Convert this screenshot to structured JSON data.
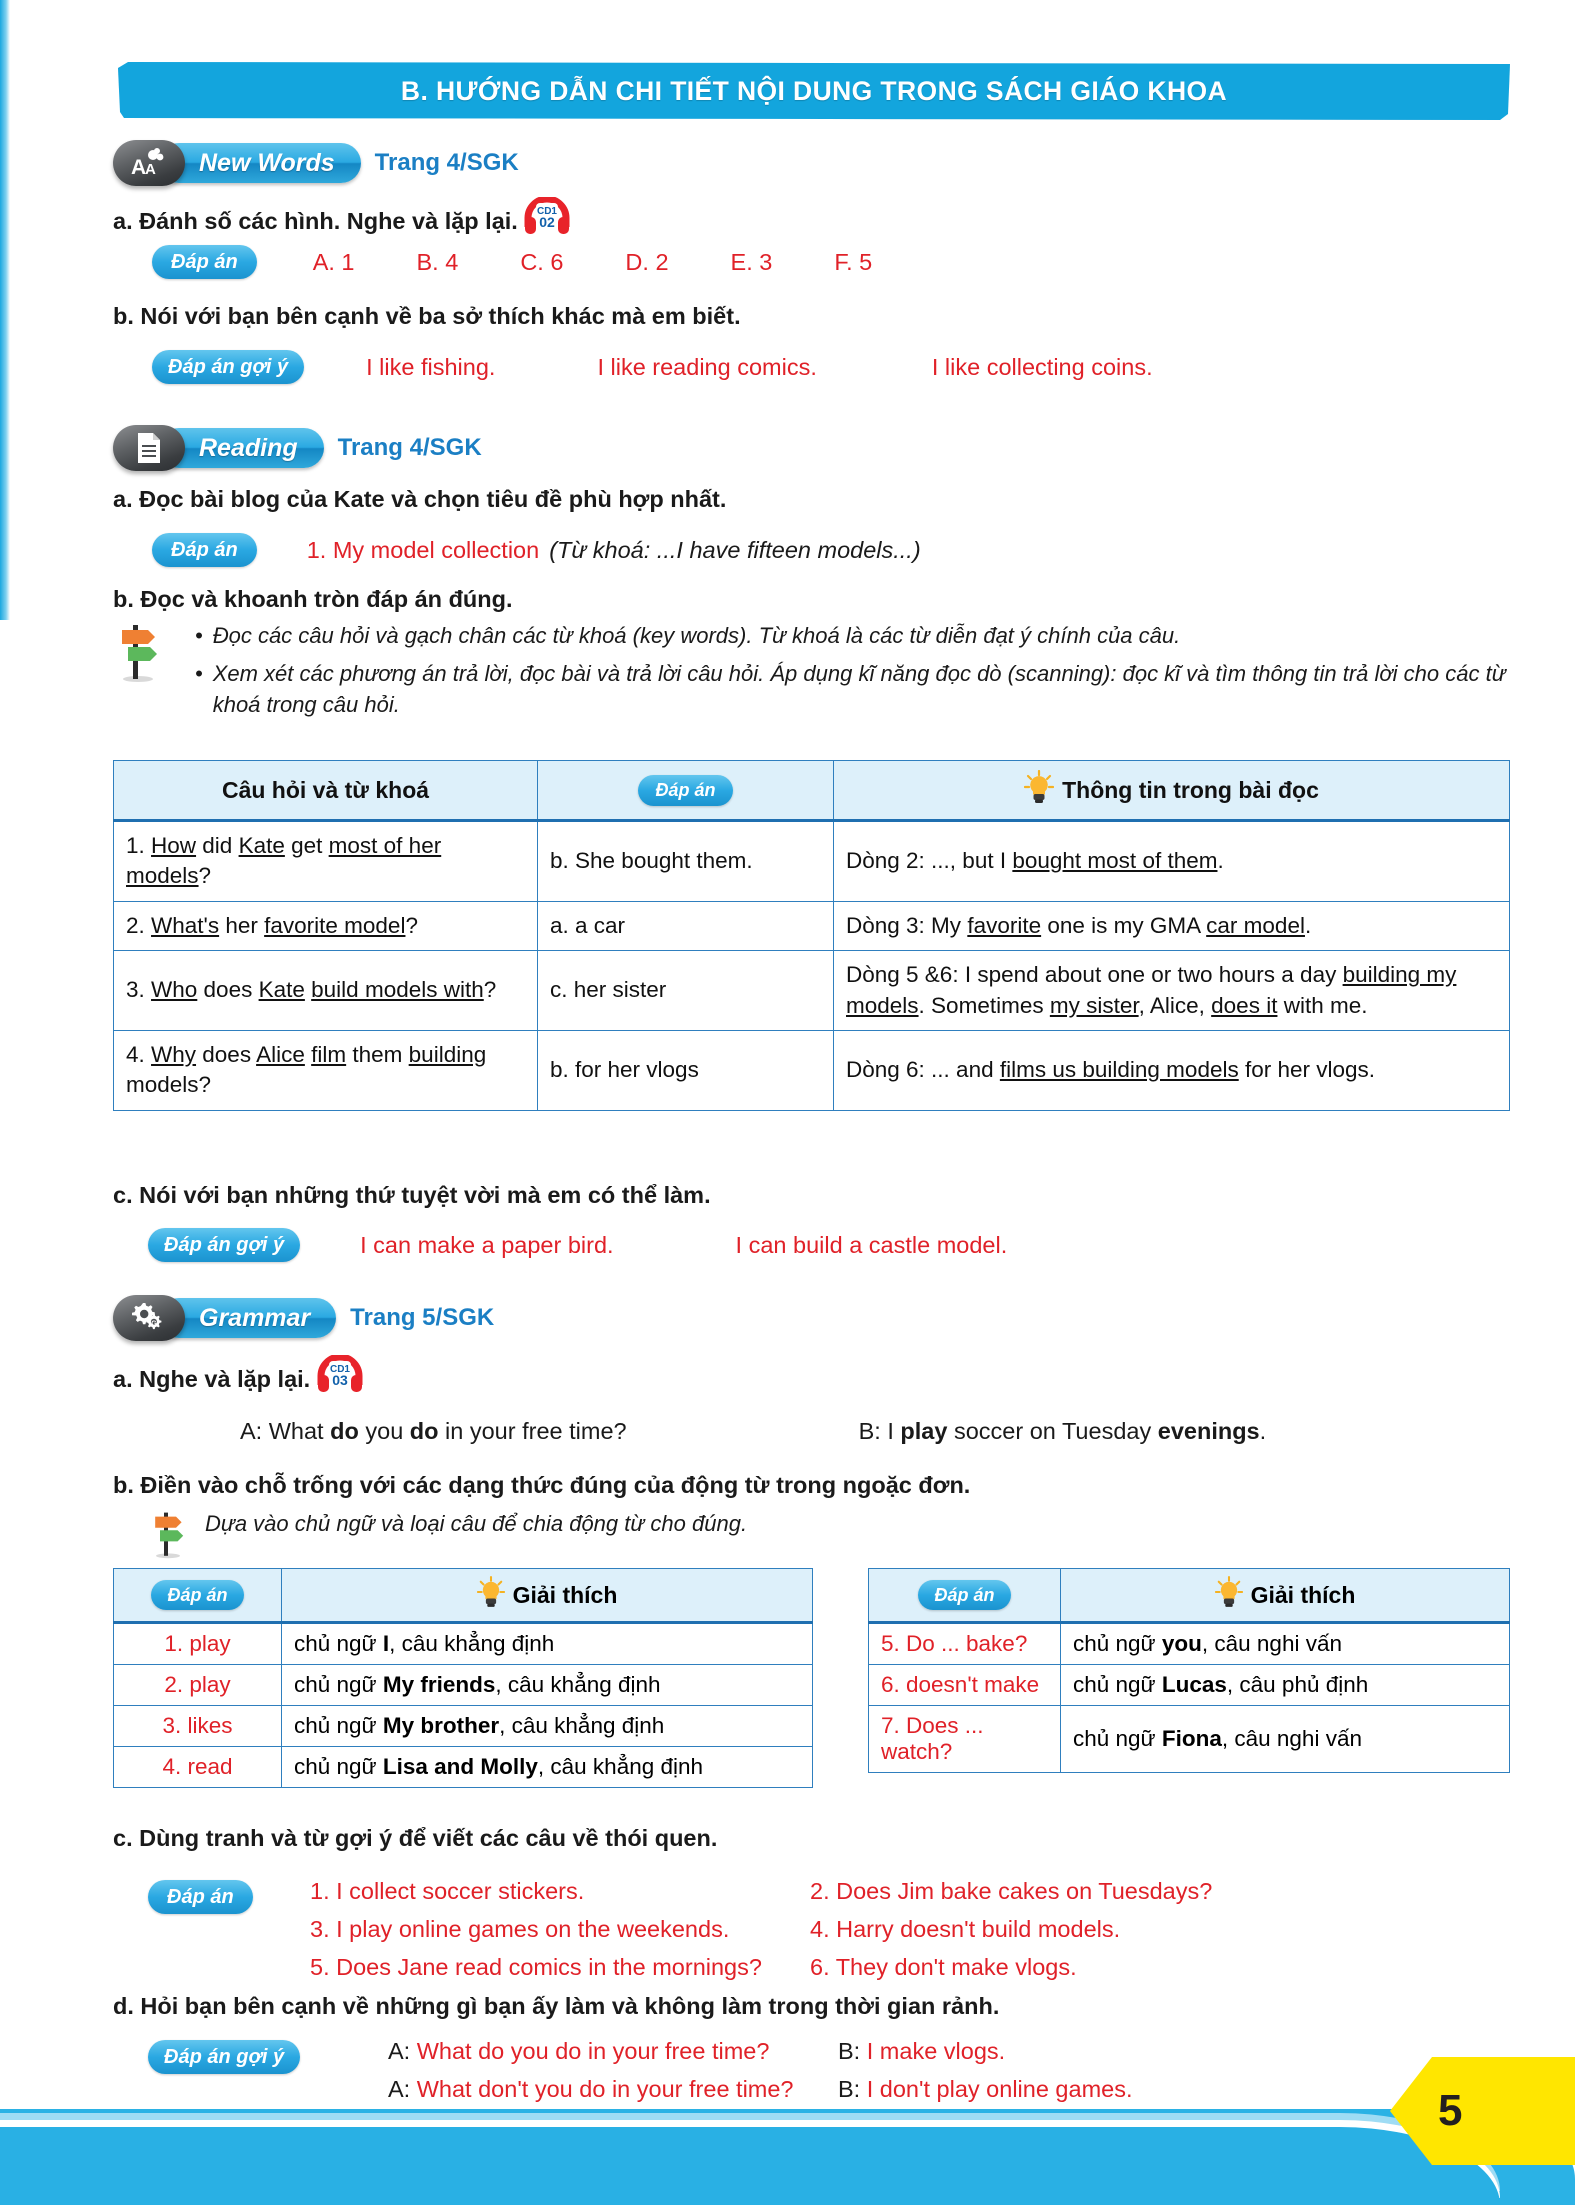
{
  "banner": {
    "title": "B. HƯỚNG DẪN CHI TIẾT NỘI DUNG TRONG SÁCH GIÁO KHOA"
  },
  "sections": {
    "new_words": {
      "name": "New Words",
      "page_ref": "Trang 4/SGK",
      "icon": "aa-letters-icon",
      "a": {
        "prompt": "a. Đánh số các hình. Nghe và lặp lại.",
        "audio": {
          "cd": "CD1",
          "track": "02"
        },
        "chip": "Đáp án",
        "answers": [
          "A. 1",
          "B. 4",
          "C. 6",
          "D. 2",
          "E. 3",
          "F. 5"
        ]
      },
      "b": {
        "prompt": "b. Nói với bạn bên cạnh về ba sở thích khác mà em biết.",
        "chip": "Đáp án gợi ý",
        "answers": [
          "I like fishing.",
          "I like reading comics.",
          "I like collecting coins."
        ]
      }
    },
    "reading": {
      "name": "Reading",
      "page_ref": "Trang 4/SGK",
      "icon": "document-icon",
      "a": {
        "prompt": "a. Đọc bài blog của Kate và chọn tiêu đề phù hợp nhất.",
        "chip": "Đáp án",
        "answer": "1. My model collection",
        "note": "(Từ khoá: ...I have fifteen models...)"
      },
      "b": {
        "prompt": "b. Đọc và khoanh tròn đáp án đúng.",
        "tips": [
          "Đọc các câu hỏi và gạch chân các từ khoá (key words). Từ khoá là các từ diễn đạt ý chính của câu.",
          "Xem xét các phương án trả lời, đọc bài và trả lời câu hỏi. Áp dụng kĩ năng đọc dò (scanning): đọc kĩ và tìm thông tin trả lời cho các từ khoá trong câu hỏi."
        ],
        "table": {
          "headers": [
            "Câu hỏi và từ khoá",
            "Đáp án",
            "Thông tin trong bài đọc"
          ],
          "rows": [
            {
              "question": "1. How did Kate get most of her models?",
              "answer": "b. She bought them.",
              "info": "Dòng 2: ..., but I bought most of them."
            },
            {
              "question": "2. What's her favorite model?",
              "answer": "a. a car",
              "info": "Dòng 3: My favorite one is my GMA car model."
            },
            {
              "question": "3. Who does Kate build models with?",
              "answer": "c. her sister",
              "info": "Dòng 5 &6: I spend about one or two hours a day building my models. Sometimes my sister, Alice, does it with me."
            },
            {
              "question": "4. Why does Alice film them building models?",
              "answer": "b. for her vlogs",
              "info": "Dòng 6: ... and films us building models for her vlogs."
            }
          ]
        }
      },
      "c": {
        "prompt": "c. Nói với bạn những thứ tuyệt vời mà em có thể làm.",
        "chip": "Đáp án gợi ý",
        "answers": [
          "I can make a paper bird.",
          "I can build a castle model."
        ]
      }
    },
    "grammar": {
      "name": "Grammar",
      "page_ref": "Trang 5/SGK",
      "icon": "gears-icon",
      "a": {
        "prompt": "a. Nghe và lặp lại.",
        "audio": {
          "cd": "CD1",
          "track": "03"
        },
        "dialog_a_pre": "A: What ",
        "dialog_a_b1": "do",
        "dialog_a_mid": " you ",
        "dialog_a_b2": "do",
        "dialog_a_post": " in your free time?",
        "dialog_b_pre": "B: I ",
        "dialog_b_b1": "play",
        "dialog_b_mid": " soccer on Tuesday ",
        "dialog_b_b2": "evenings",
        "dialog_b_post": "."
      },
      "b": {
        "prompt": "b. Điền vào chỗ trống với các dạng thức đúng của động từ trong ngoặc đơn.",
        "tip": "Dựa vào chủ ngữ và loại câu để chia động từ cho đúng.",
        "table_left": {
          "headers": [
            "Đáp án",
            "Giải thích"
          ],
          "rows": [
            {
              "answer": "1. play",
              "pre": "chủ ngữ ",
              "bold": "I",
              "post": ", câu khẳng định"
            },
            {
              "answer": "2. play",
              "pre": "chủ ngữ ",
              "bold": "My friends",
              "post": ", câu khẳng định"
            },
            {
              "answer": "3. likes",
              "pre": "chủ ngữ ",
              "bold": "My brother",
              "post": ", câu khẳng định"
            },
            {
              "answer": "4. read",
              "pre": "chủ ngữ ",
              "bold": "Lisa and Molly",
              "post": ", câu khẳng định"
            }
          ]
        },
        "table_right": {
          "headers": [
            "Đáp án",
            "Giải thích"
          ],
          "rows": [
            {
              "answer": "5. Do ... bake?",
              "pre": "chủ ngữ ",
              "bold": "you",
              "post": ", câu nghi vấn"
            },
            {
              "answer": "6. doesn't make",
              "pre": "chủ ngữ ",
              "bold": "Lucas",
              "post": ", câu phủ định"
            },
            {
              "answer": "7. Does ... watch?",
              "pre": "chủ ngữ ",
              "bold": "Fiona",
              "post": ", câu nghi vấn"
            }
          ]
        }
      },
      "c": {
        "prompt": "c. Dùng tranh và từ gợi ý để viết các câu về thói quen.",
        "chip": "Đáp án",
        "answers": [
          "1. I collect soccer stickers.",
          "2. Does Jim bake cakes on Tuesdays?",
          "3. I play online games on the weekends.",
          "4. Harry doesn't build models.",
          "5. Does Jane read comics in the mornings?",
          "6. They don't make vlogs."
        ]
      },
      "d": {
        "prompt": "d. Hỏi bạn bên cạnh về những gì bạn ấy làm và không làm trong thời gian rảnh.",
        "chip": "Đáp án gợi ý",
        "lines": [
          {
            "a_label": "A: ",
            "a_text": "What do you do in your free time?",
            "b_label": "B: ",
            "b_text": "I make vlogs."
          },
          {
            "a_label": "A: ",
            "a_text": "What don't you do in your free time?",
            "b_label": "B: ",
            "b_text": "I don't play online games."
          }
        ]
      }
    }
  },
  "footer": {
    "page_number": "5"
  },
  "colors": {
    "accent_blue": "#13a5dd",
    "answer_red": "#e02128",
    "table_border": "#2f7fbe",
    "header_fill": "#ddf0fa",
    "page_badge": "#ffe600"
  }
}
